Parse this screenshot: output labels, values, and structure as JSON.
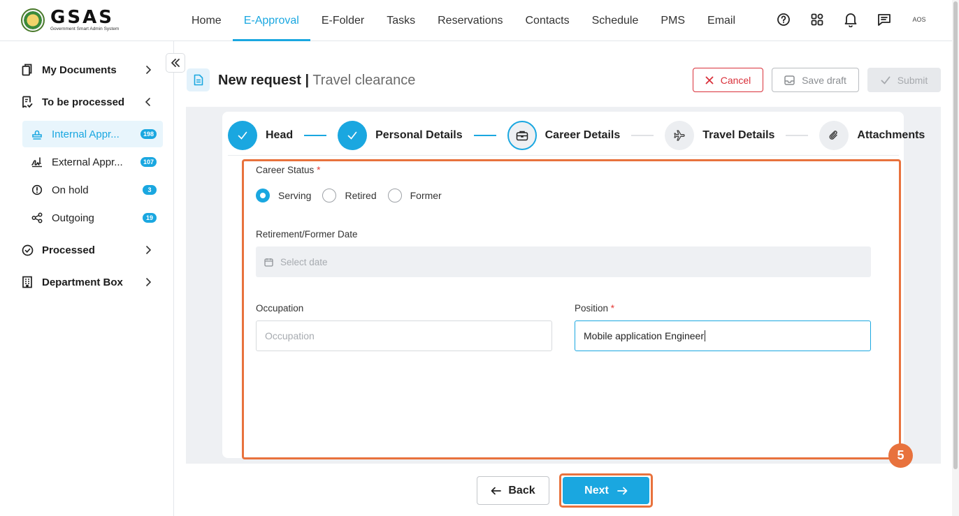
{
  "logo": {
    "name": "GSAS",
    "subtitle": "Government Smart Admin System"
  },
  "nav": {
    "items": [
      {
        "label": "Home",
        "active": false
      },
      {
        "label": "E-Approval",
        "active": true
      },
      {
        "label": "E-Folder",
        "active": false
      },
      {
        "label": "Tasks",
        "active": false
      },
      {
        "label": "Reservations",
        "active": false
      },
      {
        "label": "Contacts",
        "active": false
      },
      {
        "label": "Schedule",
        "active": false
      },
      {
        "label": "PMS",
        "active": false
      },
      {
        "label": "Email",
        "active": false
      }
    ],
    "icons": [
      "help-icon",
      "apps-grid-icon",
      "bell-icon",
      "chat-icon"
    ],
    "avatar_text": "AOS"
  },
  "sidebar": {
    "my_documents": "My Documents",
    "to_be_processed": "To be processed",
    "sub_items": [
      {
        "label": "Internal Appr...",
        "count": "198",
        "active": true
      },
      {
        "label": "External Appr...",
        "count": "107",
        "active": false
      },
      {
        "label": "On hold",
        "count": "3",
        "active": false
      },
      {
        "label": "Outgoing",
        "count": "19",
        "active": false
      }
    ],
    "processed": "Processed",
    "department_box": "Department Box"
  },
  "header": {
    "title": "New request",
    "separator": "|",
    "subtitle": "Travel clearance",
    "cancel": "Cancel",
    "save_draft": "Save draft",
    "submit": "Submit"
  },
  "stepper": [
    {
      "label": "Head",
      "state": "done",
      "icon": "check-icon"
    },
    {
      "label": "Personal Details",
      "state": "done",
      "icon": "check-icon"
    },
    {
      "label": "Career Details",
      "state": "current",
      "icon": "briefcase-icon"
    },
    {
      "label": "Travel Details",
      "state": "todo",
      "icon": "plane-icon"
    },
    {
      "label": "Attachments",
      "state": "todo",
      "icon": "paperclip-icon"
    }
  ],
  "form": {
    "career_status_label": "Career Status",
    "required_mark": "*",
    "career_status_options": [
      "Serving",
      "Retired",
      "Former"
    ],
    "career_status_selected": "Serving",
    "retirement_date_label": "Retirement/Former Date",
    "retirement_date_placeholder": "Select date",
    "occupation_label": "Occupation",
    "occupation_placeholder": "Occupation",
    "occupation_value": "",
    "position_label": "Position",
    "position_value": "Mobile application Engineer"
  },
  "footer": {
    "back": "Back",
    "next": "Next"
  },
  "annotation": {
    "step_number": "5"
  },
  "colors": {
    "accent": "#1aa7e0",
    "danger": "#d9303a",
    "highlight": "#e8723d"
  }
}
